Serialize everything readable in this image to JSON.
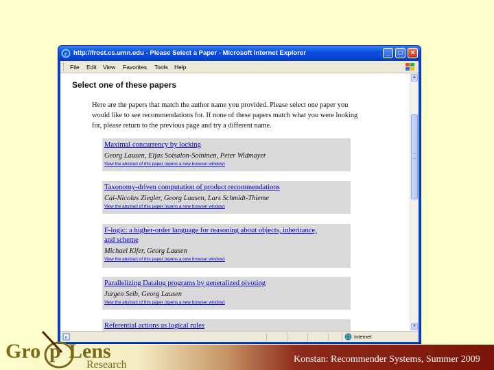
{
  "window": {
    "title": "http://frost.cs.umn.edu - Please Select a Paper - Microsoft Internet Explorer",
    "menu": [
      "File",
      "Edit",
      "View",
      "Favorites",
      "Tools",
      "Help"
    ],
    "status_zone": "Internet"
  },
  "page": {
    "heading": "Select one of these papers",
    "intro": "Here are the papers that match the author name you provided. Please select one paper you would like to see recommendations for. If none of these papers match what you were looking for, please return to the previous page and try a different name.",
    "papers": [
      {
        "title": "Maximal concurrency by locking",
        "authors": "Georg Lausen, Eljas Soisalon-Soininen, Peter Widmayer",
        "link": "View the abstract of this paper (opens a new browser window)"
      },
      {
        "title": "Taxonomy-driven computation of product recommendations",
        "authors": "Cai-Nicolas Ziegler, Georg Lausen, Lars Schmidt-Thieme",
        "link": "View the abstract of this paper (opens a new browser window)"
      },
      {
        "title": "F-logic: a higher-order language for reasoning about objects, inheritance, and scheme",
        "authors": "Michael Kifer, Georg Lausen",
        "link": "View the abstract of this paper (opens a new browser window)"
      },
      {
        "title": "Parallelizing Datalog programs by generalized pivoting",
        "authors": "Jurgen Seib, Georg Lausen",
        "link": "View the abstract of this paper (opens a new browser window)"
      },
      {
        "title": "Referential actions as logical rules",
        "authors": "",
        "link": ""
      }
    ]
  },
  "slide": {
    "logo_main": "GroupLens",
    "logo_sub": "Research",
    "footer": "Konstan: Recommender Systems, Summer 2009"
  },
  "icons": {
    "ie": "ie-icon",
    "windows_logo": "windows-logo-icon",
    "page": "page-icon",
    "zone": "globe-icon"
  },
  "colors": {
    "slide_background": "#ffffcc",
    "titlebar_blue": "#0a4fe0",
    "link_blue": "#0000cc",
    "paper_box": "#d9d9d9",
    "banner_red": "#8e2a1a"
  }
}
